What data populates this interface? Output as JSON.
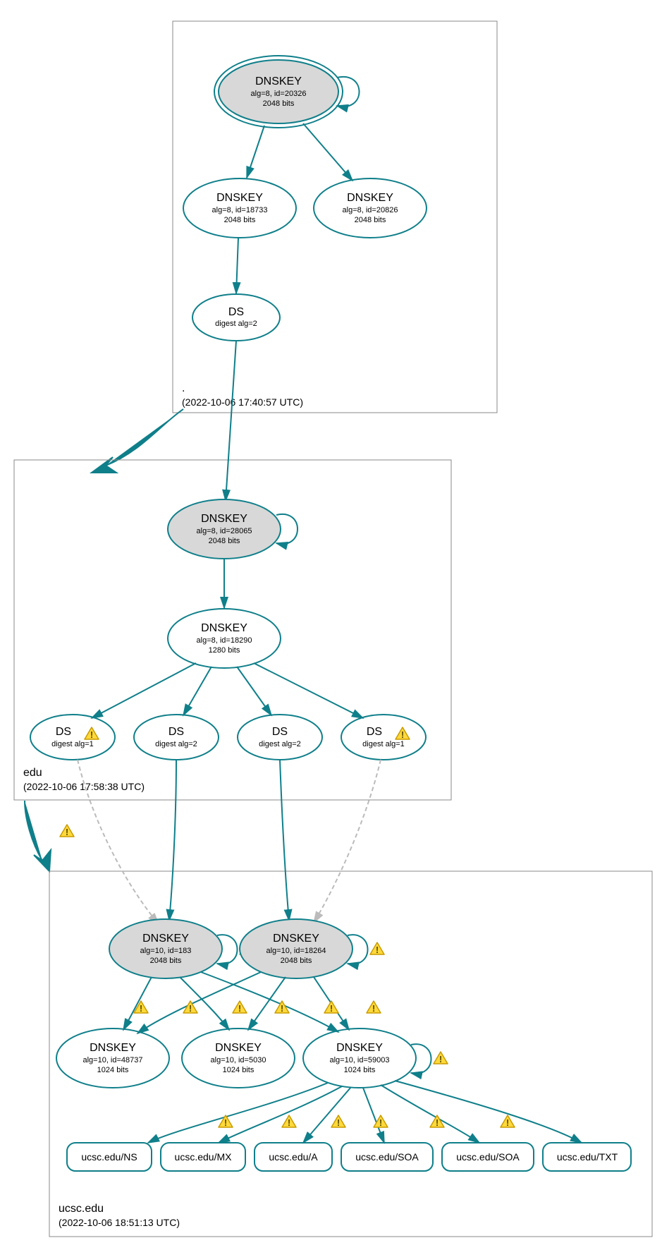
{
  "zones": {
    "root": {
      "label": ".",
      "timestamp": "(2022-10-06 17:40:57 UTC)"
    },
    "tld": {
      "label": "edu",
      "timestamp": "(2022-10-06 17:58:38 UTC)"
    },
    "dom": {
      "label": "ucsc.edu",
      "timestamp": "(2022-10-06 18:51:13 UTC)"
    }
  },
  "nodes": {
    "root_ksk": {
      "title": "DNSKEY",
      "sub1": "alg=8, id=20326",
      "sub2": "2048 bits"
    },
    "root_zsk1": {
      "title": "DNSKEY",
      "sub1": "alg=8, id=18733",
      "sub2": "2048 bits"
    },
    "root_zsk2": {
      "title": "DNSKEY",
      "sub1": "alg=8, id=20826",
      "sub2": "2048 bits"
    },
    "root_ds": {
      "title": "DS",
      "sub1": "digest alg=2"
    },
    "edu_ksk": {
      "title": "DNSKEY",
      "sub1": "alg=8, id=28065",
      "sub2": "2048 bits"
    },
    "edu_zsk": {
      "title": "DNSKEY",
      "sub1": "alg=8, id=18290",
      "sub2": "1280 bits"
    },
    "edu_ds1": {
      "title": "DS",
      "sub1": "digest alg=1"
    },
    "edu_ds2": {
      "title": "DS",
      "sub1": "digest alg=2"
    },
    "edu_ds3": {
      "title": "DS",
      "sub1": "digest alg=2"
    },
    "edu_ds4": {
      "title": "DS",
      "sub1": "digest alg=1"
    },
    "dom_ksk1": {
      "title": "DNSKEY",
      "sub1": "alg=10, id=183",
      "sub2": "2048 bits"
    },
    "dom_ksk2": {
      "title": "DNSKEY",
      "sub1": "alg=10, id=18264",
      "sub2": "2048 bits"
    },
    "dom_zsk1": {
      "title": "DNSKEY",
      "sub1": "alg=10, id=48737",
      "sub2": "1024 bits"
    },
    "dom_zsk2": {
      "title": "DNSKEY",
      "sub1": "alg=10, id=5030",
      "sub2": "1024 bits"
    },
    "dom_zsk3": {
      "title": "DNSKEY",
      "sub1": "alg=10, id=59003",
      "sub2": "1024 bits"
    }
  },
  "rr": {
    "ns": "ucsc.edu/NS",
    "mx": "ucsc.edu/MX",
    "a": "ucsc.edu/A",
    "soa1": "ucsc.edu/SOA",
    "soa2": "ucsc.edu/SOA",
    "txt": "ucsc.edu/TXT"
  },
  "colors": {
    "teal": "#0f7f8a",
    "grey_fill": "#d8d8d8",
    "warn_fill": "#ffd93b",
    "warn_stroke": "#c89b00"
  }
}
